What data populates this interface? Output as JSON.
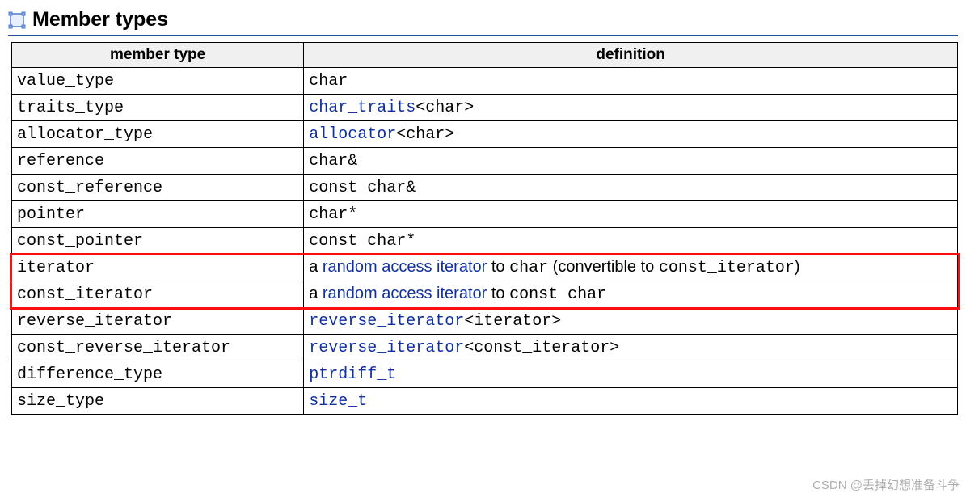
{
  "section_title": "Member types",
  "headers": {
    "c1": "member type",
    "c2": "definition"
  },
  "rows": [
    {
      "type": "value_type",
      "def": [
        {
          "t": "mono",
          "v": "char"
        }
      ]
    },
    {
      "type": "traits_type",
      "def": [
        {
          "t": "link",
          "v": "char_traits"
        },
        {
          "t": "mono",
          "v": "<char>"
        }
      ]
    },
    {
      "type": "allocator_type",
      "def": [
        {
          "t": "link",
          "v": "allocator"
        },
        {
          "t": "mono",
          "v": "<char>"
        }
      ]
    },
    {
      "type": "reference",
      "def": [
        {
          "t": "mono",
          "v": "char&"
        }
      ]
    },
    {
      "type": "const_reference",
      "def": [
        {
          "t": "mono",
          "v": "const char&"
        }
      ]
    },
    {
      "type": "pointer",
      "def": [
        {
          "t": "mono",
          "v": "char*"
        }
      ]
    },
    {
      "type": "const_pointer",
      "def": [
        {
          "t": "mono",
          "v": "const char*"
        }
      ]
    },
    {
      "type": "iterator",
      "def": [
        {
          "t": "text",
          "v": "a "
        },
        {
          "t": "link-sans",
          "v": "random access iterator"
        },
        {
          "t": "text",
          "v": " to "
        },
        {
          "t": "mono",
          "v": "char"
        },
        {
          "t": "text",
          "v": " (convertible to "
        },
        {
          "t": "mono",
          "v": "const_iterator"
        },
        {
          "t": "text",
          "v": ")"
        }
      ]
    },
    {
      "type": "const_iterator",
      "def": [
        {
          "t": "text",
          "v": "a "
        },
        {
          "t": "link-sans",
          "v": "random access iterator"
        },
        {
          "t": "text",
          "v": " to "
        },
        {
          "t": "mono",
          "v": "const char"
        }
      ]
    },
    {
      "type": "reverse_iterator",
      "def": [
        {
          "t": "link",
          "v": "reverse_iterator"
        },
        {
          "t": "mono",
          "v": "<iterator>"
        }
      ]
    },
    {
      "type": "const_reverse_iterator",
      "def": [
        {
          "t": "link",
          "v": "reverse_iterator"
        },
        {
          "t": "mono",
          "v": "<const_iterator>"
        }
      ]
    },
    {
      "type": "difference_type",
      "def": [
        {
          "t": "link",
          "v": "ptrdiff_t"
        }
      ]
    },
    {
      "type": "size_type",
      "def": [
        {
          "t": "link",
          "v": "size_t"
        }
      ]
    }
  ],
  "highlight_rows": [
    7,
    8
  ],
  "watermark": "CSDN @丢掉幻想准备斗争"
}
